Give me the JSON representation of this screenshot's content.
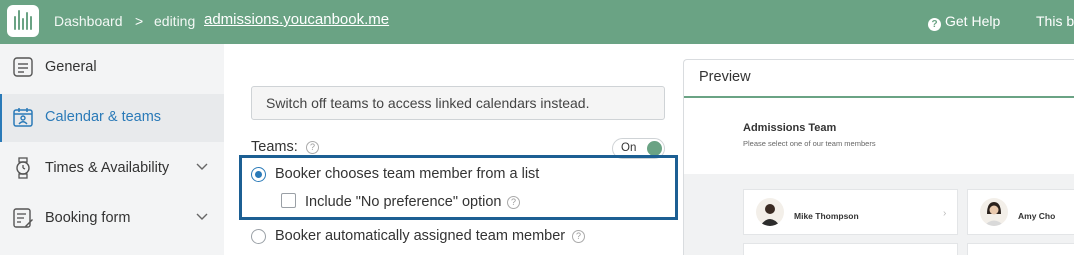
{
  "topbar": {
    "dashboard": "Dashboard",
    "separator": ">",
    "editing": "editing",
    "site": "admissions.youcanbook.me",
    "help": "Get Help",
    "cut_text": "This b"
  },
  "sidebar": {
    "items": [
      {
        "label": "General",
        "icon": "document-list-icon",
        "active": false
      },
      {
        "label": "Calendar & teams",
        "icon": "calendar-person-icon",
        "active": true
      },
      {
        "label": "Times & Availability",
        "icon": "watch-icon",
        "active": false
      },
      {
        "label": "Booking form",
        "icon": "form-edit-icon",
        "active": false
      }
    ]
  },
  "main": {
    "banner": "Switch off teams to access linked calendars instead.",
    "teams_label": "Teams:",
    "toggle_label": "On",
    "option_list": "Booker chooses team member from a list",
    "option_no_pref": "Include \"No preference\" option",
    "option_auto": "Booker automatically assigned team member"
  },
  "preview": {
    "title": "Preview",
    "team_name": "Admissions Team",
    "team_sub": "Please select one of our team members",
    "members": [
      "Mike Thompson",
      "Amy Cho"
    ]
  },
  "colors": {
    "brand": "#6aa384",
    "accent": "#2a7ab8",
    "highlight_border": "#1c5f93"
  }
}
